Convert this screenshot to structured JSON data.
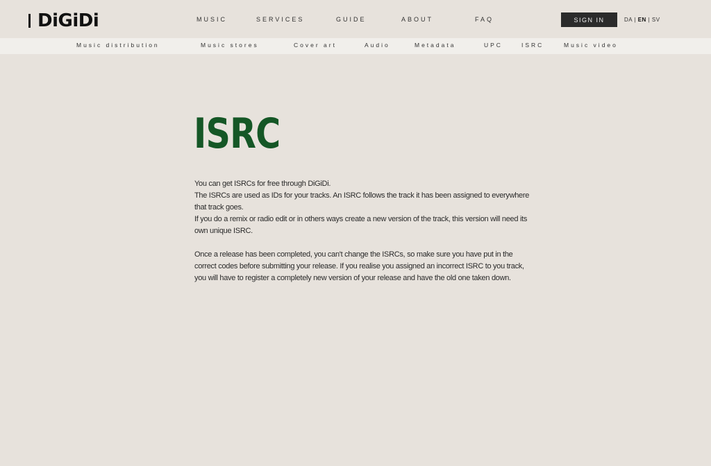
{
  "brand": {
    "name": "DiGiDi"
  },
  "nav": [
    {
      "label": "MUSIC"
    },
    {
      "label": "SERVICES"
    },
    {
      "label": "GUIDE"
    },
    {
      "label": "ABOUT"
    },
    {
      "label": "FAQ"
    }
  ],
  "signin_label": "SIGN IN",
  "languages": {
    "da": "DA",
    "sep1": " | ",
    "en": "EN",
    "sep2": " | ",
    "sv": "SV"
  },
  "subnav": [
    {
      "label": "Music distribution"
    },
    {
      "label": "Music stores"
    },
    {
      "label": "Cover art"
    },
    {
      "label": "Audio"
    },
    {
      "label": "Metadata"
    },
    {
      "label": "UPC"
    },
    {
      "label": "ISRC"
    },
    {
      "label": "Music video"
    }
  ],
  "page": {
    "title": "ISRC",
    "lines": [
      "You can get ISRCs for free through DiGiDi.",
      "The ISRCs are used as IDs for your tracks. An ISRC follows the track it has been assigned to everywhere that track goes.",
      "If you do a remix or radio edit or in others ways create a new version of the track, this version will need its own unique ISRC."
    ],
    "paragraph2": "Once a release has been completed, you can't change the ISRCs, so make sure you have put in the correct codes before submitting your release. If you realise you assigned an incorrect ISRC to you track, you will have to register a completely new version of your release and have the old one taken down."
  },
  "colors": {
    "background": "#e7e2dc",
    "title": "#155726",
    "signin_bg": "#2b2b2b",
    "subnav_bg": "#f1efeb"
  }
}
